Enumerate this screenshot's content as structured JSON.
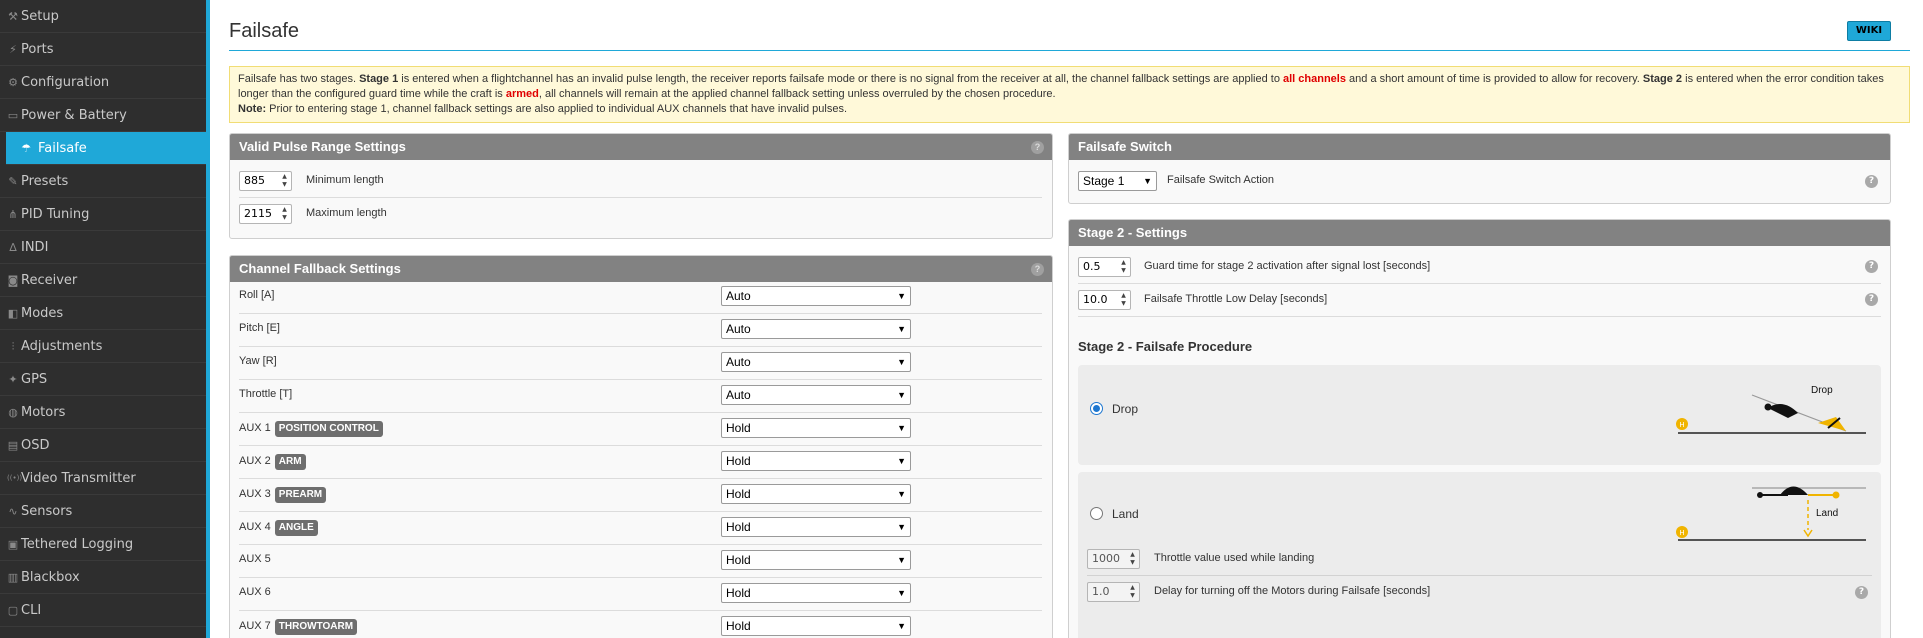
{
  "sidebar": {
    "items": [
      {
        "label": "Setup",
        "icon": "wrench-icon",
        "glyph": "⚒"
      },
      {
        "label": "Ports",
        "icon": "plug-icon",
        "glyph": "⚡"
      },
      {
        "label": "Configuration",
        "icon": "gear-icon",
        "glyph": "⚙"
      },
      {
        "label": "Power & Battery",
        "icon": "battery-icon",
        "glyph": "▭"
      },
      {
        "label": "Failsafe",
        "icon": "parachute-icon",
        "glyph": "☂"
      },
      {
        "label": "Presets",
        "icon": "presets-icon",
        "glyph": "✎"
      },
      {
        "label": "PID Tuning",
        "icon": "pid-icon",
        "glyph": "⋔"
      },
      {
        "label": "INDI",
        "icon": "indi-icon",
        "glyph": "∆"
      },
      {
        "label": "Receiver",
        "icon": "receiver-icon",
        "glyph": "◙"
      },
      {
        "label": "Modes",
        "icon": "modes-icon",
        "glyph": "◧"
      },
      {
        "label": "Adjustments",
        "icon": "adjustments-icon",
        "glyph": "⫶"
      },
      {
        "label": "GPS",
        "icon": "gps-icon",
        "glyph": "✦"
      },
      {
        "label": "Motors",
        "icon": "motors-icon",
        "glyph": "◍"
      },
      {
        "label": "OSD",
        "icon": "osd-icon",
        "glyph": "▤"
      },
      {
        "label": "Video Transmitter",
        "icon": "vtx-icon",
        "glyph": "((•))"
      },
      {
        "label": "Sensors",
        "icon": "sensors-icon",
        "glyph": "∿"
      },
      {
        "label": "Tethered Logging",
        "icon": "logging-icon",
        "glyph": "▣"
      },
      {
        "label": "Blackbox",
        "icon": "blackbox-icon",
        "glyph": "▥"
      },
      {
        "label": "CLI",
        "icon": "cli-icon",
        "glyph": "▢"
      }
    ],
    "active_index": 4
  },
  "header": {
    "title": "Failsafe",
    "wiki_label": "WIKI"
  },
  "note": {
    "t1": "Failsafe has two stages. ",
    "b1": "Stage 1",
    "t2": " is entered when a flightchannel has an invalid pulse length, the receiver reports failsafe mode or there is no signal from the receiver at all, the channel fallback settings are applied to ",
    "r1": "all channels",
    "t3": " and a short amount of time is provided to allow for recovery. ",
    "b2": "Stage 2",
    "t4": " is entered when the error condition takes longer than the configured guard time while the craft is ",
    "r2": "armed",
    "t5": ", all channels will remain at the applied channel fallback setting unless overruled by the chosen procedure.",
    "b3": "Note:",
    "t6": " Prior to entering stage 1, channel fallback settings are also applied to individual AUX channels that have invalid pulses."
  },
  "pulse_range": {
    "title": "Valid Pulse Range Settings",
    "min_value": "885",
    "min_label": "Minimum length",
    "max_value": "2115",
    "max_label": "Maximum length"
  },
  "fallback": {
    "title": "Channel Fallback Settings",
    "rows": [
      {
        "label": "Roll [A]",
        "badge": "",
        "value": "Auto"
      },
      {
        "label": "Pitch [E]",
        "badge": "",
        "value": "Auto"
      },
      {
        "label": "Yaw [R]",
        "badge": "",
        "value": "Auto"
      },
      {
        "label": "Throttle [T]",
        "badge": "",
        "value": "Auto"
      },
      {
        "label": "AUX 1",
        "badge": "POSITION CONTROL",
        "value": "Hold"
      },
      {
        "label": "AUX 2",
        "badge": "ARM",
        "value": "Hold"
      },
      {
        "label": "AUX 3",
        "badge": "PREARM",
        "value": "Hold"
      },
      {
        "label": "AUX 4",
        "badge": "ANGLE",
        "value": "Hold"
      },
      {
        "label": "AUX 5",
        "badge": "",
        "value": "Hold"
      },
      {
        "label": "AUX 6",
        "badge": "",
        "value": "Hold"
      },
      {
        "label": "AUX 7",
        "badge": "THROWTOARM",
        "value": "Hold"
      }
    ]
  },
  "switch": {
    "title": "Failsafe Switch",
    "value": "Stage 1",
    "label": "Failsafe Switch Action"
  },
  "stage2": {
    "title": "Stage 2 - Settings",
    "guard_value": "0.5",
    "guard_label": "Guard time for stage 2 activation after signal lost [seconds]",
    "throttle_low_value": "10.0",
    "throttle_low_label": "Failsafe Throttle Low Delay [seconds]",
    "procedure_title": "Stage 2 - Failsafe Procedure",
    "drop_label": "Drop",
    "drop_diagram_label": "Drop",
    "land_label": "Land",
    "land_diagram_label": "Land",
    "land_throttle_value": "1000",
    "land_throttle_label": "Throttle value used while landing",
    "land_delay_value": "1.0",
    "land_delay_label": "Delay for turning off the Motors during Failsafe [seconds]",
    "home_marker": "H"
  },
  "colors": {
    "accent": "#1fa8d8",
    "sidebar_bg": "#2e2e2e",
    "panel_head": "#828282",
    "note_bg": "#fff9d9",
    "alert_red": "#e00000",
    "diagram_yellow": "#f0b400"
  }
}
